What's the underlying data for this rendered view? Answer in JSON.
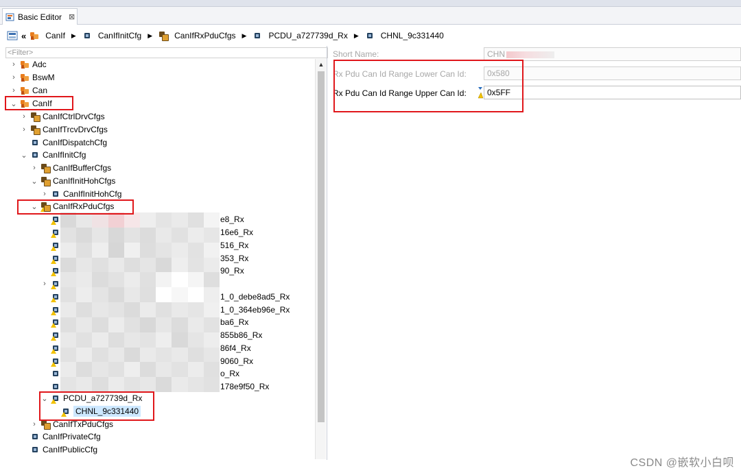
{
  "editor": {
    "tab_label": "Basic Editor",
    "tab_close": "⊠"
  },
  "breadcrumb": [
    "CanIf",
    "CanIfInitCfg",
    "CanIfRxPduCfgs",
    "PCDU_a727739d_Rx",
    "CHNL_9c331440"
  ],
  "filter": {
    "placeholder": "<Filter>"
  },
  "tree": {
    "adc": "Adc",
    "bswm": "BswM",
    "can": "Can",
    "canif": "CanIf",
    "ctrl": "CanIfCtrlDrvCfgs",
    "trcv": "CanIfTrcvDrvCfgs",
    "dispatch": "CanIfDispatchCfg",
    "init": "CanIfInitCfg",
    "buffer": "CanIfBufferCfgs",
    "hoh": "CanIfInitHohCfgs",
    "hohcfg": "CanIfInitHohCfg",
    "rxpdu": "CanIfRxPduCfgs",
    "rx_items": [
      "e8_Rx",
      "16e6_Rx",
      "516_Rx",
      "353_Rx",
      "90_Rx",
      "",
      "1_0_debe8ad5_Rx",
      "1_0_364eb96e_Rx",
      "ba6_Rx",
      "855b86_Rx",
      "86f4_Rx",
      "9060_Rx",
      "o_Rx",
      "178e9f50_Rx"
    ],
    "pcdu": "PCDU_a727739d_Rx",
    "chnl": "CHNL_9c331440",
    "txpdu": "CanIfTxPduCfgs",
    "private": "CanIfPrivateCfg",
    "public": "CanIfPublicCfg"
  },
  "properties": {
    "short_name_label": "Short Name:",
    "short_name_value": "CHN",
    "lower_label": "Rx Pdu Can Id Range Lower Can Id:",
    "lower_value": "0x580",
    "upper_label": "Rx Pdu Can Id Range Upper Can Id:",
    "upper_value": "0x5FF"
  },
  "watermark": "CSDN @嵌软小白呗"
}
